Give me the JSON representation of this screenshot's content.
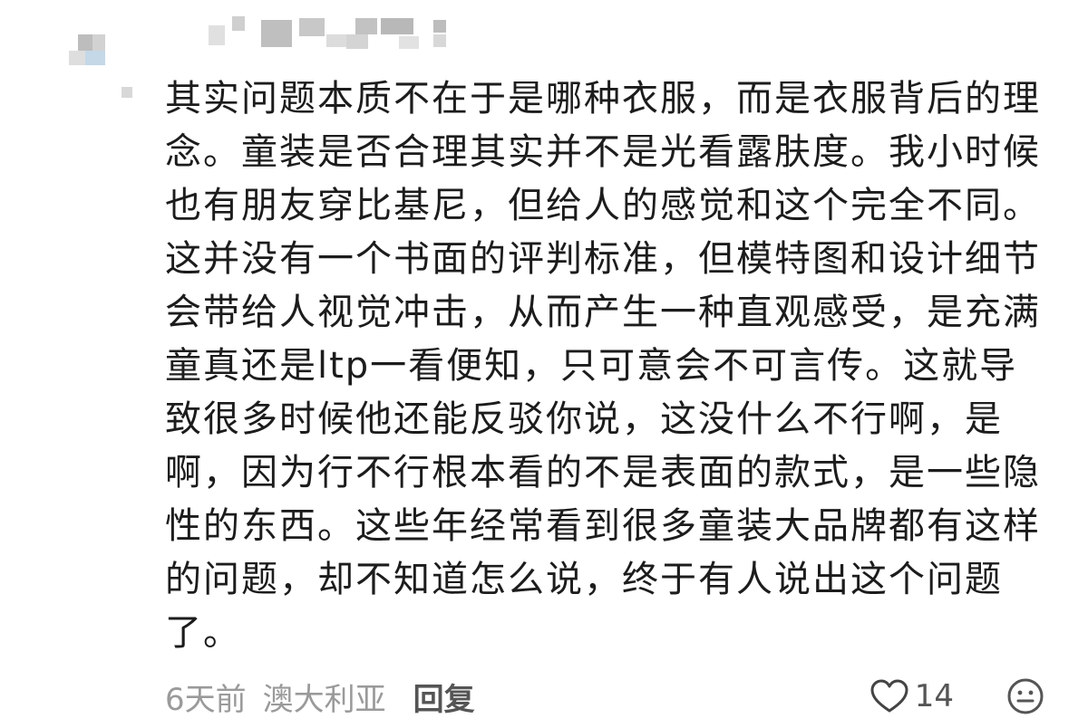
{
  "comment": {
    "text": "其实问题本质不在于是哪种衣服，而是衣服背后的理念。童装是否合理其实并不是光看露肤度。我小时候也有朋友穿比基尼，但给人的感觉和这个完全不同。这并没有一个书面的评判标准，但模特图和设计细节会带给人视觉冲击，从而产生一种直观感受，是充满童真还是ltp一看便知，只可意会不可言传。这就导致很多时候他还能反驳你说，这没什么不行啊，是啊，因为行不行根本看的不是表面的款式，是一些隐性的东西。这些年经常看到很多童装大品牌都有这样的问题，却不知道怎么说，终于有人说出这个问题了。"
  },
  "meta": {
    "time": "6天前",
    "location": "澳大利亚",
    "reply_label": "回复"
  },
  "actions": {
    "like_count": "14",
    "like_icon": "heart-outline-icon",
    "emoji_icon": "emoji-face-icon"
  },
  "colors": {
    "text": "#1c1c1c",
    "meta": "#9a9a9a",
    "action": "#555555"
  }
}
